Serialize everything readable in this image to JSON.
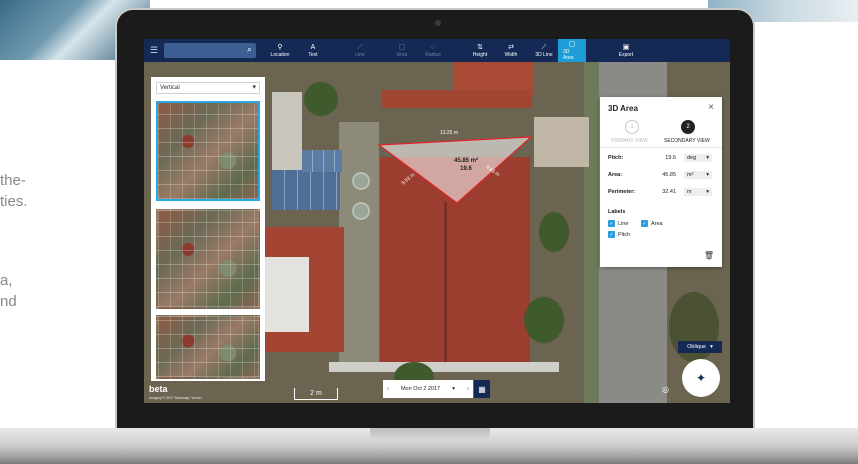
{
  "side_copy": {
    "line_a1": "the-",
    "line_a2": "ties.",
    "line_b1": "a,",
    "line_b2": "nd"
  },
  "toolbar": {
    "menu_icon": "hamburger-icon",
    "search_icon": "search-icon",
    "tools": [
      {
        "label": "Location",
        "icon": "pin-icon"
      },
      {
        "label": "Text",
        "icon": "text-icon"
      },
      {
        "label": "Line",
        "icon": "line-chart-icon"
      },
      {
        "label": "Area",
        "icon": "square-icon"
      },
      {
        "label": "Radius",
        "icon": "circle-icon"
      },
      {
        "label": "Height",
        "icon": "height-icon"
      },
      {
        "label": "Width",
        "icon": "width-icon"
      },
      {
        "label": "3D Line",
        "icon": "3d-line-icon"
      },
      {
        "label": "3D Area",
        "icon": "3d-area-icon"
      },
      {
        "label": "Export",
        "icon": "image-icon"
      }
    ],
    "active_tool": "3D Area",
    "colors": {
      "bar": "#142a55",
      "active": "#1e9ed8"
    }
  },
  "strip": {
    "dropdown_value": "Vertical",
    "selected_thumb": 0
  },
  "measure": {
    "area_label": "45.85 m²",
    "pitch_label": "19.6",
    "top_edge": "13.25 m",
    "left_edge": "9.53 m",
    "right_edge": "9.63 m"
  },
  "panel": {
    "title": "3D Area",
    "step1_num": "1",
    "step1_label": "PRIMARY VIEW",
    "step2_num": "2",
    "step2_label": "SECONDARY VIEW",
    "pitch_label": "Pitch:",
    "pitch_value": "19.6",
    "pitch_unit": "deg",
    "area_label": "Area:",
    "area_value": "45.85",
    "area_unit": "m²",
    "perimeter_label": "Perimeter:",
    "perimeter_value": "32.41",
    "perimeter_unit": "m",
    "labels_title": "Labels",
    "labels": [
      {
        "name": "Line",
        "checked": true
      },
      {
        "name": "Area",
        "checked": true
      },
      {
        "name": "Pitch",
        "checked": true
      }
    ]
  },
  "footer": {
    "beta": "beta",
    "copyright": "Imagery © 2017 Nearmap, Vexcel",
    "scale": "2 m",
    "date": "Mon Oct 2 2017",
    "view": "Oblique"
  }
}
